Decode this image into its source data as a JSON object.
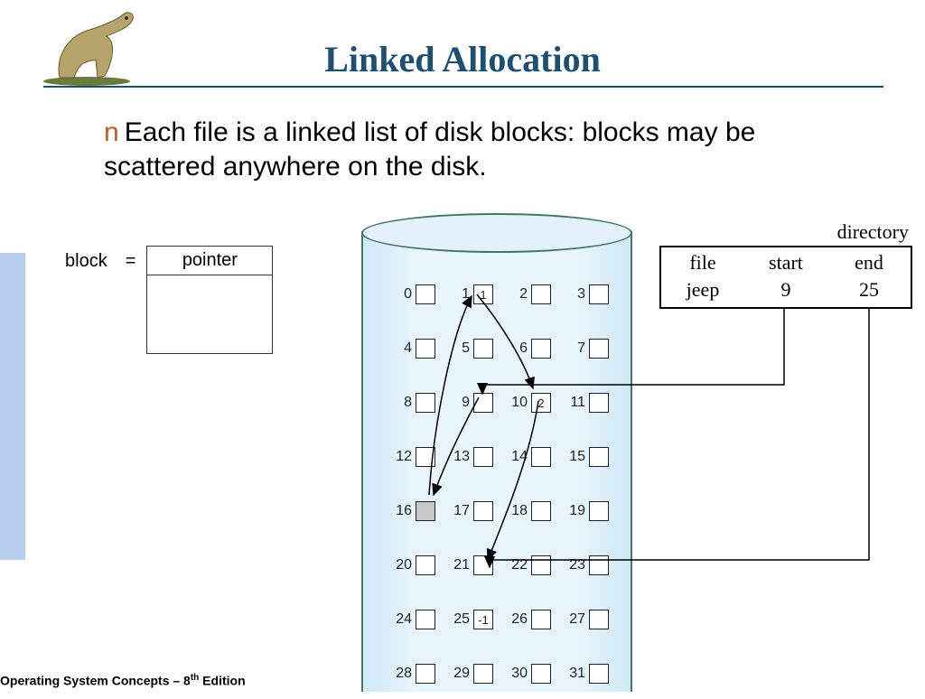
{
  "title": "Linked Allocation",
  "bullet_marker": "n",
  "body_text": "Each file is a linked list of disk blocks: blocks may be scattered anywhere on the disk.",
  "block_def": {
    "label": "block",
    "equals": "=",
    "pointer_label": "pointer"
  },
  "directory": {
    "label": "directory",
    "headers": [
      "file",
      "start",
      "end"
    ],
    "row": [
      "jeep",
      "9",
      "25"
    ]
  },
  "disk": {
    "labels": [
      "0",
      "1",
      "2",
      "3",
      "4",
      "5",
      "6",
      "7",
      "8",
      "9",
      "10",
      "11",
      "12",
      "13",
      "14",
      "15",
      "16",
      "17",
      "18",
      "19",
      "20",
      "21",
      "22",
      "23",
      "24",
      "25",
      "26",
      "27",
      "28",
      "29",
      "30",
      "31"
    ],
    "contents": {
      "1": "1",
      "10": "2",
      "25": "-1"
    },
    "shaded": [
      16
    ]
  },
  "footer": {
    "prefix": "Operating System Concepts – 8",
    "sup": "th",
    "suffix": " Edition"
  }
}
